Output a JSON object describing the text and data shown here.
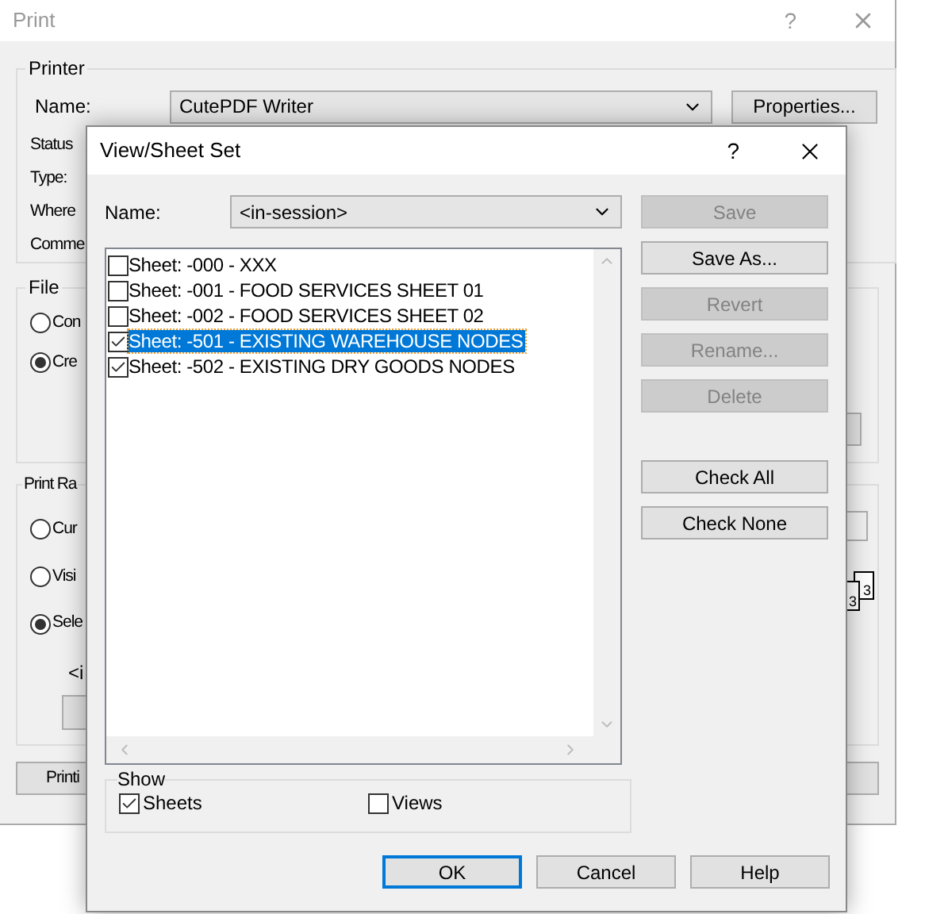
{
  "print_window": {
    "title": "Print",
    "help": "?",
    "printer_group": {
      "label": "Printer",
      "name_label": "Name:",
      "printer": "CutePDF Writer",
      "properties_button": "Properties...",
      "field_labels": [
        "Status",
        "Type:",
        "Where",
        "Comme"
      ]
    },
    "file_group": {
      "label": "File",
      "options": [
        {
          "label": "Con",
          "selected": false
        },
        {
          "label": "Cre",
          "selected": true
        }
      ]
    },
    "print_range_group": {
      "label": "Print Ra",
      "options": [
        {
          "label": "Cur",
          "selected": false
        },
        {
          "label": "Visi",
          "selected": false
        },
        {
          "label": "Sele",
          "selected": true
        }
      ],
      "set_text": "<i"
    },
    "collate_pages": [
      "3",
      "3"
    ],
    "bottom_button": "Printi"
  },
  "sheet_dialog": {
    "title": "View/Sheet Set",
    "help": "?",
    "name_label": "Name:",
    "name_value": "<in-session>",
    "list_items": [
      {
        "label": "Sheet: -000 - XXX",
        "checked": false,
        "selected": false
      },
      {
        "label": "Sheet: -001 - FOOD SERVICES SHEET 01",
        "checked": false,
        "selected": false
      },
      {
        "label": "Sheet: -002 - FOOD SERVICES SHEET 02",
        "checked": false,
        "selected": false
      },
      {
        "label": "Sheet: -501 - EXISTING WAREHOUSE NODES",
        "checked": true,
        "selected": true
      },
      {
        "label": "Sheet: -502 - EXISTING DRY GOODS NODES",
        "checked": true,
        "selected": false
      }
    ],
    "side_buttons": [
      {
        "label": "Save",
        "disabled": true
      },
      {
        "label": "Save As...",
        "disabled": false
      },
      {
        "label": "Revert",
        "disabled": true
      },
      {
        "label": "Rename...",
        "disabled": true
      },
      {
        "label": "Delete",
        "disabled": true
      }
    ],
    "check_buttons": [
      {
        "label": "Check All"
      },
      {
        "label": "Check None"
      }
    ],
    "show_group": {
      "label": "Show",
      "options": [
        {
          "label": "Sheets",
          "checked": true
        },
        {
          "label": "Views",
          "checked": false
        }
      ]
    },
    "footer_buttons": [
      {
        "label": "OK",
        "default": true
      },
      {
        "label": "Cancel",
        "default": false
      },
      {
        "label": "Help",
        "default": false
      }
    ]
  }
}
